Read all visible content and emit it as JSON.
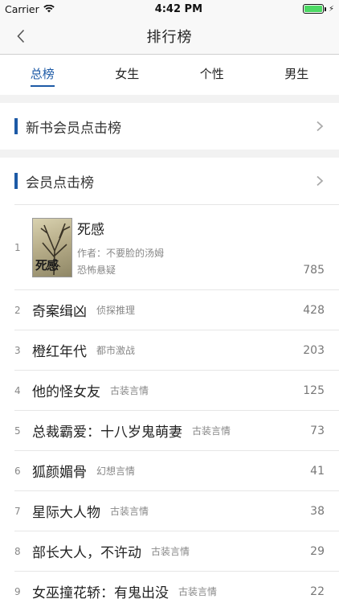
{
  "status": {
    "carrier": "Carrier",
    "time": "4:42 PM"
  },
  "nav": {
    "title": "排行榜"
  },
  "tabs": [
    {
      "label": "总榜",
      "active": true
    },
    {
      "label": "女生",
      "active": false
    },
    {
      "label": "个性",
      "active": false
    },
    {
      "label": "男生",
      "active": false
    }
  ],
  "sections": {
    "new_member": "新书会员点击榜",
    "member": "会员点击榜"
  },
  "featured": {
    "rank": "1",
    "title": "死感",
    "author": "作者：不要脸的汤姆",
    "genre": "恐怖悬疑",
    "count": "785",
    "cover_text": "死感"
  },
  "books": [
    {
      "rank": "2",
      "title": "奇案缉凶",
      "genre": "侦探推理",
      "count": "428"
    },
    {
      "rank": "3",
      "title": "橙红年代",
      "genre": "都市激战",
      "count": "203"
    },
    {
      "rank": "4",
      "title": "他的怪女友",
      "genre": "古装言情",
      "count": "125"
    },
    {
      "rank": "5",
      "title": "总裁霸爱：十八岁鬼萌妻",
      "genre": "古装言情",
      "count": "73"
    },
    {
      "rank": "6",
      "title": "狐颜媚骨",
      "genre": "幻想言情",
      "count": "41"
    },
    {
      "rank": "7",
      "title": "星际大人物",
      "genre": "古装言情",
      "count": "38"
    },
    {
      "rank": "8",
      "title": "部长大人，不许动",
      "genre": "古装言情",
      "count": "29"
    },
    {
      "rank": "9",
      "title": "女巫撞花轿：有鬼出没",
      "genre": "古装言情",
      "count": "22"
    }
  ],
  "colors": {
    "accent": "#1d5aa6",
    "battery": "#4cd964"
  }
}
